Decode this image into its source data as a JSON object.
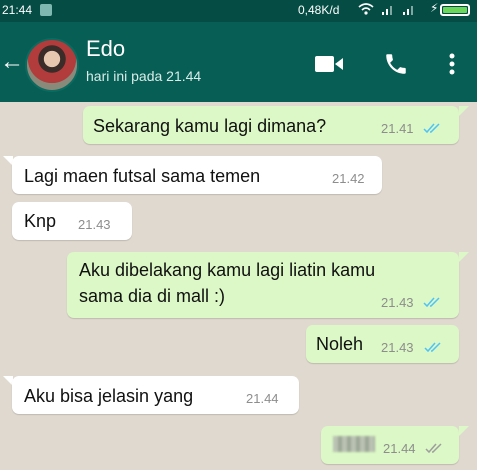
{
  "status_bar": {
    "time": "21:44",
    "network_speed": "0,48K/d",
    "battery_color": "#6bd65a"
  },
  "header": {
    "contact_name": "Edo",
    "last_seen": "hari ini pada 21.44",
    "background": "#075e54"
  },
  "messages": [
    {
      "direction": "out",
      "text": "Sekarang kamu lagi dimana?",
      "time": "21.41",
      "status": "read"
    },
    {
      "direction": "in",
      "text": "Lagi maen futsal sama temen",
      "time": "21.42"
    },
    {
      "direction": "in",
      "text": "Knp",
      "time": "21.43"
    },
    {
      "direction": "out",
      "text_line1": "Aku dibelakang kamu lagi liatin kamu",
      "text_line2": "sama dia di mall :)",
      "time": "21.43",
      "status": "read"
    },
    {
      "direction": "out",
      "text": "Noleh",
      "time": "21.43",
      "status": "read"
    },
    {
      "direction": "in",
      "text": "Aku bisa jelasin yang",
      "time": "21.44"
    },
    {
      "direction": "out",
      "text": "",
      "time": "21.44",
      "status": "delivered",
      "content_hidden": true
    }
  ],
  "colors": {
    "outgoing_bubble": "#dcf8c6",
    "incoming_bubble": "#ffffff",
    "read_ticks": "#4fc3f7",
    "delivered_ticks": "#9e9e9e",
    "chat_background": "#e0d9cf"
  },
  "icons": [
    "back-arrow-icon",
    "video-call-icon",
    "phone-call-icon",
    "overflow-menu-icon",
    "wifi-icon",
    "signal-icon",
    "battery-icon"
  ]
}
